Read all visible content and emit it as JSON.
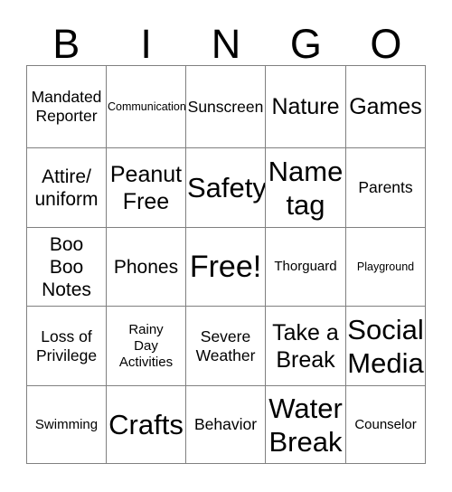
{
  "card": {
    "title_letters": [
      "B",
      "I",
      "N",
      "G",
      "O"
    ],
    "background_color": "#ffffff",
    "border_color": "#808080",
    "text_color": "#000000",
    "columns": 5,
    "rows": 5,
    "cells": [
      [
        {
          "label": "Mandated\nReporter",
          "size": "md"
        },
        {
          "label": "Communication",
          "size": "xs"
        },
        {
          "label": "Sunscreen",
          "size": "md"
        },
        {
          "label": "Nature",
          "size": "xl"
        },
        {
          "label": "Games",
          "size": "xl"
        }
      ],
      [
        {
          "label": "Attire/\nuniform",
          "size": "lg"
        },
        {
          "label": "Peanut\nFree",
          "size": "xl"
        },
        {
          "label": "Safety",
          "size": "xxl"
        },
        {
          "label": "Name\ntag",
          "size": "xxl"
        },
        {
          "label": "Parents",
          "size": "md"
        }
      ],
      [
        {
          "label": "Boo\nBoo\nNotes",
          "size": "lg"
        },
        {
          "label": "Phones",
          "size": "lg"
        },
        {
          "label": "Free!",
          "size": "free"
        },
        {
          "label": "Thorguard",
          "size": "sm"
        },
        {
          "label": "Playground",
          "size": "xs"
        }
      ],
      [
        {
          "label": "Loss of\nPrivilege",
          "size": "md"
        },
        {
          "label": "Rainy\nDay\nActivities",
          "size": "sm"
        },
        {
          "label": "Severe\nWeather",
          "size": "md"
        },
        {
          "label": "Take a\nBreak",
          "size": "xl"
        },
        {
          "label": "Social\nMedia",
          "size": "xxl"
        }
      ],
      [
        {
          "label": "Swimming",
          "size": "sm"
        },
        {
          "label": "Crafts",
          "size": "xxl"
        },
        {
          "label": "Behavior",
          "size": "md"
        },
        {
          "label": "Water\nBreak",
          "size": "xxl"
        },
        {
          "label": "Counselor",
          "size": "sm"
        }
      ]
    ]
  }
}
